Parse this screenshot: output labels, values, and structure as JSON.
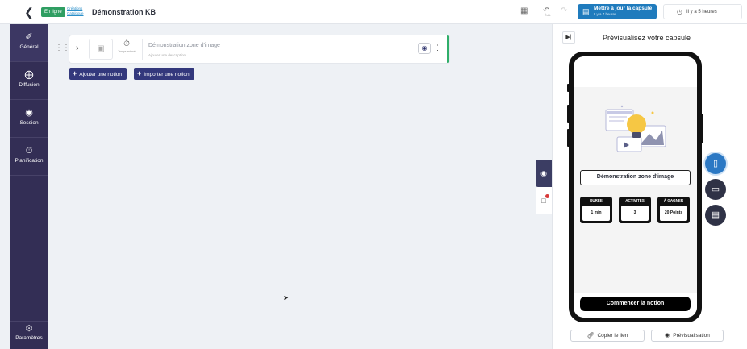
{
  "topbar": {
    "status_badge": "En ligne",
    "breadcrumb_line1": "Créations",
    "breadcrumb_line2": "Catalogue",
    "title": "Démonstration KB",
    "undo_caption": "Édit.",
    "update_button": {
      "label": "Mettre à jour la capsule",
      "sub": "Il y a 7 heures"
    },
    "history": "Il y a 5 heures"
  },
  "sidebar": {
    "items": [
      {
        "label": "Général"
      },
      {
        "label": "Diffusion"
      },
      {
        "label": "Session"
      },
      {
        "label": "Planification"
      }
    ],
    "bottom": {
      "label": "Paramètres"
    }
  },
  "notion": {
    "timer_label": "Temps estimé",
    "name": "Démonstration zone d'image",
    "description": "Ajouter une description"
  },
  "buttons": {
    "add_notion": "Ajouter une notion",
    "import_notion": "Importer une notion"
  },
  "preview": {
    "title": "Prévisualisez votre capsule",
    "phone": {
      "notion_title": "Démonstration zone d'image",
      "stats": [
        {
          "label": "DURÉE",
          "value": "1 min"
        },
        {
          "label": "ACTIVITÉS",
          "value": "3"
        },
        {
          "label": "À GAGNER",
          "value": "20 Points"
        }
      ],
      "start_button": "Commencer la notion"
    },
    "copy_link": "Copier le lien",
    "preview_button": "Prévisualisation"
  },
  "colors": {
    "sidebar": "#332e55",
    "accent_blue": "#1f7bbd",
    "button_navy": "#33387c",
    "online_green": "#2f9e62",
    "bulb_yellow": "#f6c744"
  },
  "icons": {
    "back": "chevron-left-icon",
    "sidebar": [
      "brush-icon",
      "share-icon",
      "target-icon",
      "clock-icon",
      "gear-icon"
    ],
    "devices": [
      "smartphone-icon",
      "tablet-icon",
      "laptop-icon"
    ]
  }
}
